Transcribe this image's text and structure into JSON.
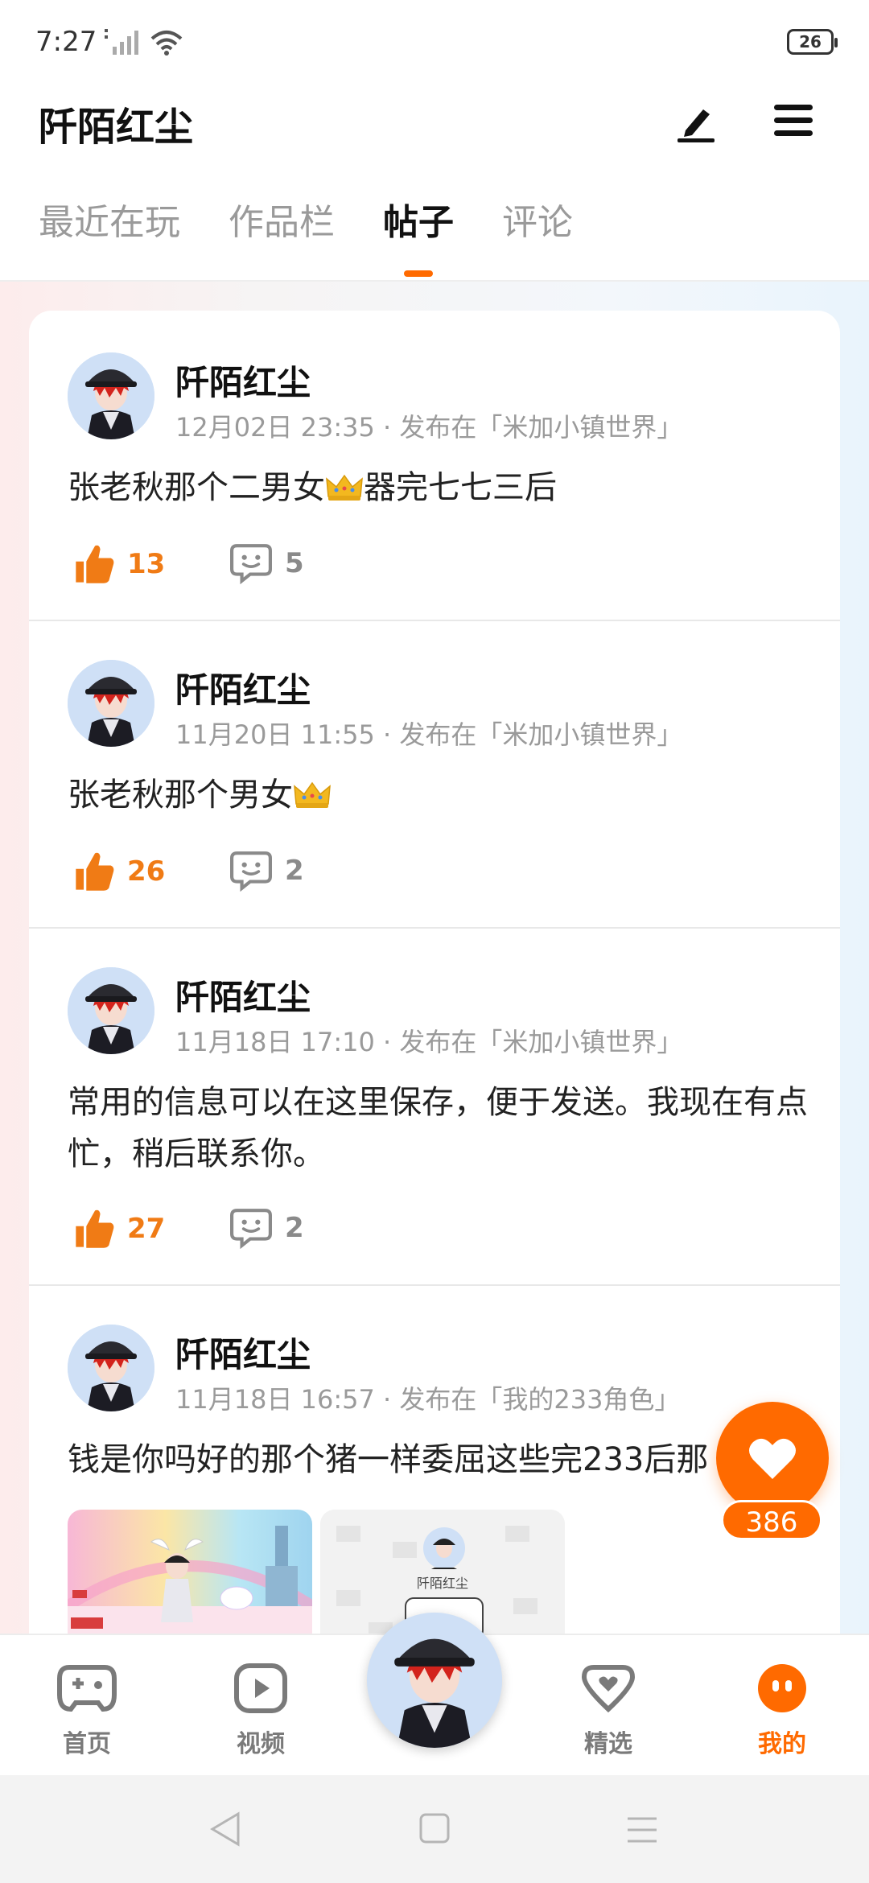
{
  "status_bar": {
    "time": "7:27",
    "battery": "26"
  },
  "header": {
    "title": "阡陌红尘"
  },
  "tabs": [
    {
      "label": "最近在玩"
    },
    {
      "label": "作品栏"
    },
    {
      "label": "帖子"
    },
    {
      "label": "评论"
    }
  ],
  "active_tab": "帖子",
  "posts": [
    {
      "author": "阡陌红尘",
      "meta": "12月02日 23:35 · 发布在「米加小镇世界」",
      "text_a": "张老秋那个二男女",
      "text_b": "器完七七三后",
      "likes": "13",
      "comments": "5"
    },
    {
      "author": "阡陌红尘",
      "meta": "11月20日 11:55 · 发布在「米加小镇世界」",
      "text_a": "张老秋那个男女",
      "text_b": "",
      "likes": "26",
      "comments": "2"
    },
    {
      "author": "阡陌红尘",
      "meta": "11月18日 17:10 · 发布在「米加小镇世界」",
      "text_a": "常用的信息可以在这里保存，便于发送。我现在有点忙，稍后联系你。",
      "text_b": "",
      "likes": "27",
      "comments": "2"
    },
    {
      "author": "阡陌红尘",
      "meta": "11月18日 16:57 · 发布在「我的233角色」",
      "text_a": "钱是你吗好的那个猪一样委屈这些完233后那",
      "text_b": "",
      "thumb_caption": "阡陌红尘"
    }
  ],
  "float_like": {
    "count": "386"
  },
  "bottom_nav": [
    {
      "label": "首页"
    },
    {
      "label": "视频"
    },
    {
      "label": "精选"
    },
    {
      "label": "我的"
    }
  ],
  "colors": {
    "accent": "#ff6a00",
    "like": "#f07b15"
  }
}
